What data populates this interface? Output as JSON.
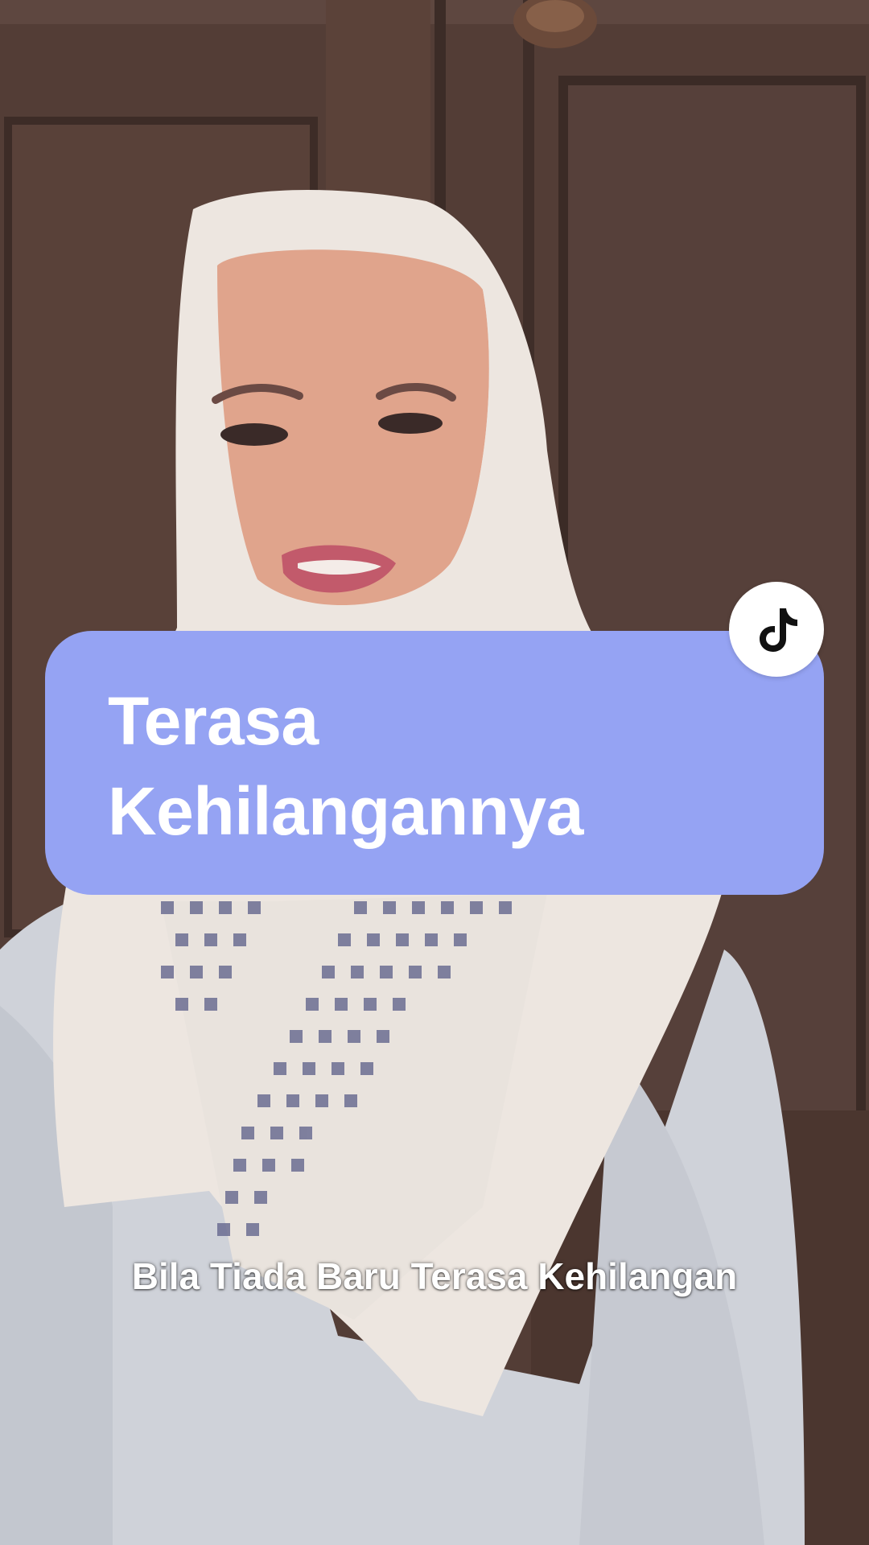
{
  "video": {
    "title_card": {
      "line1": "Terasa",
      "line2": "Kehilangannya",
      "background_color": "#95a3f3",
      "text_color": "#ffffff"
    },
    "logo": {
      "icon": "tiktok-note-icon",
      "badge_color": "#ffffff",
      "icon_color": "#111111"
    },
    "caption": "Bila Tiada Baru Terasa Kehilangan"
  }
}
